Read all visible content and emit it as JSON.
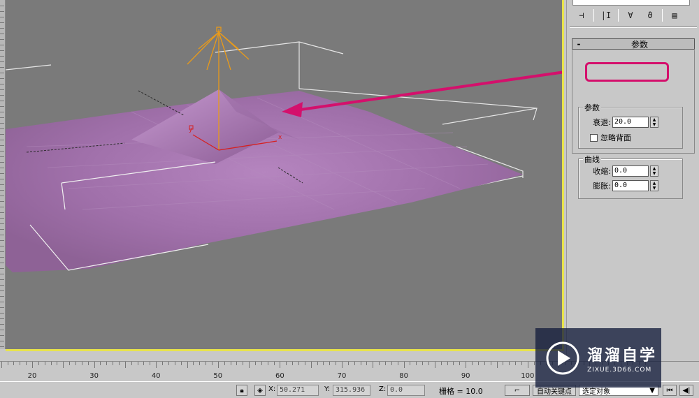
{
  "panel": {
    "rollout": {
      "collapse": "-",
      "title": "参数"
    },
    "params_group": {
      "label": "参数",
      "falloff_label": "衰退:",
      "falloff_value": "20.0",
      "ignore_backface_label": "忽略背面",
      "ignore_backface_checked": false
    },
    "curve_group": {
      "label": "曲线",
      "pinch_label": "收缩:",
      "pinch_value": "0.0",
      "bubble_label": "膨胀:",
      "bubble_value": "0.0"
    },
    "toolbar_icons": [
      "pin-stack-icon",
      "show-end-result-icon",
      "make-unique-icon",
      "remove-modifier-icon",
      "configure-modifier-sets-icon"
    ]
  },
  "viewport": {
    "gizmo_axis_labels": {
      "x": "x",
      "y": "y"
    },
    "colors": {
      "background": "#7a7a7a",
      "surface": "#a878b0",
      "border_active": "#e8e34a",
      "highlight": "#d4106c",
      "gizmo": "#e89a1a",
      "axis": "#d62020"
    }
  },
  "ruler": {
    "labels": [
      "20",
      "30",
      "40",
      "50",
      "60",
      "70",
      "80",
      "90",
      "100"
    ]
  },
  "status": {
    "x_label": "X:",
    "x_value": "50.271",
    "y_label": "Y:",
    "y_value": "315.936",
    "z_label": "Z:",
    "z_value": "0.0",
    "grid_text": "栅格 = 10.0",
    "auto_key": "自动关键点",
    "selection_dropdown": "选定对象"
  },
  "watermark": {
    "title": "溜溜自学",
    "url": "ZIXUE.3D66.COM"
  }
}
